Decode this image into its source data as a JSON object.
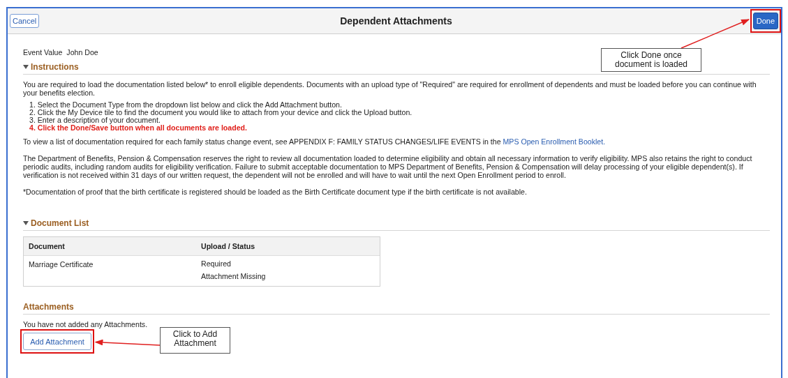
{
  "header": {
    "cancel": "Cancel",
    "title": "Dependent Attachments",
    "done": "Done",
    "done_callout": "Click Done once document is loaded"
  },
  "event": {
    "label": "Event Value",
    "value": "John Doe"
  },
  "instructions": {
    "title": "Instructions",
    "expanded": true,
    "intro": "You are required to load the documentation listed below* to enroll eligible dependents. Documents with an upload type of \"Required\" are required for enrollment of dependents and must be loaded before you can continue with your benefits election.",
    "steps": [
      {
        "number": "1.",
        "text": "Select the Document Type from the dropdown list below and click the Add Attachment button.",
        "emphasis": false
      },
      {
        "number": "2.",
        "text": "Click the My Device tile to find the document you would like to attach from your device and click the Upload button.",
        "emphasis": false
      },
      {
        "number": "3.",
        "text": "Enter a description of your document.",
        "emphasis": false
      },
      {
        "number": "4.",
        "text": "Click the Done/Save button when all documents are loaded.",
        "emphasis": true
      }
    ],
    "reference": {
      "text": "To view a list of documentation required for each family status change event, see APPENDIX F: FAMILY STATUS CHANGES/LIFE EVENTS in the ",
      "link": "MPS Open Enrollment Booklet."
    },
    "notice": "The Department of Benefits, Pension & Compensation reserves the right to review all documentation loaded to determine eligibility and obtain all necessary information to verify eligibility. MPS also retains the right to conduct periodic audits, including random audits for eligibility verification. Failure to submit acceptable documentation to MPS Department of Benefits, Pension & Compensation will delay processing of your eligible dependent(s). If verification is not received within 31 days of our written request, the dependent will not be enrolled and will have to wait until the next Open Enrollment period to enroll.",
    "footnote": "*Documentation of proof that the birth certificate is registered should be loaded as the Birth Certificate document type if the birth certificate is not available."
  },
  "document_list": {
    "title": "Document List",
    "expanded": true,
    "columns": [
      "Document",
      "Upload / Status"
    ],
    "rows": [
      {
        "document": "Marriage Certificate",
        "status": [
          "Required",
          "Attachment Missing"
        ]
      }
    ]
  },
  "attachments": {
    "title": "Attachments",
    "empty_text": "You have not added any Attachments.",
    "button": "Add Attachment",
    "button_callout": "Click to Add Attachment"
  }
}
